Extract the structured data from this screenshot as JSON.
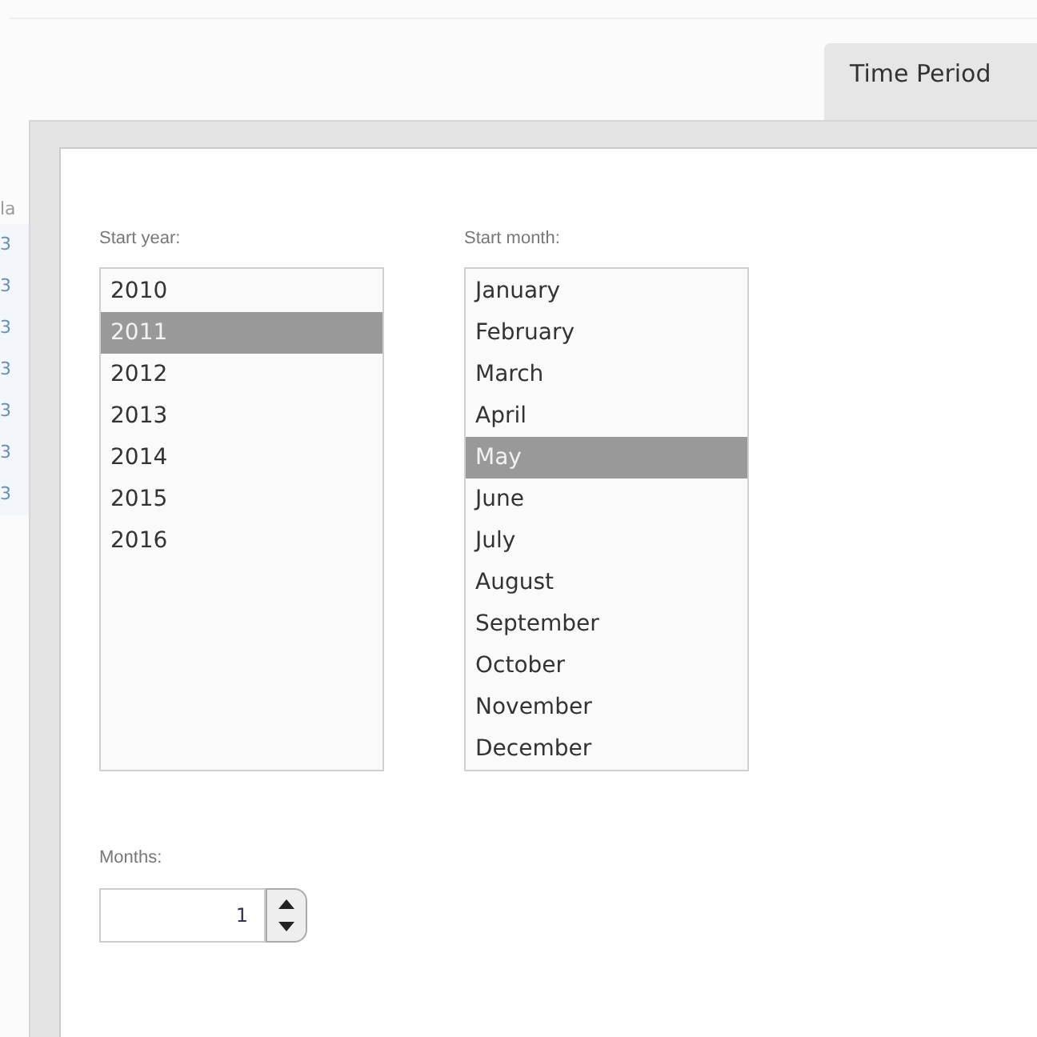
{
  "tabs": [
    {
      "label": "Time Period",
      "selected": true
    }
  ],
  "behind_table": {
    "header": "la",
    "cells": [
      "3",
      "3",
      "3",
      "3",
      "3",
      "3",
      "3"
    ]
  },
  "start_year": {
    "label": "Start year:",
    "options": [
      {
        "label": "2010",
        "selected": false
      },
      {
        "label": "2011",
        "selected": true
      },
      {
        "label": "2012",
        "selected": false
      },
      {
        "label": "2013",
        "selected": false
      },
      {
        "label": "2014",
        "selected": false
      },
      {
        "label": "2015",
        "selected": false
      },
      {
        "label": "2016",
        "selected": false
      }
    ]
  },
  "start_month": {
    "label": "Start month:",
    "options": [
      {
        "label": "January",
        "selected": false
      },
      {
        "label": "February",
        "selected": false
      },
      {
        "label": "March",
        "selected": false
      },
      {
        "label": "April",
        "selected": false
      },
      {
        "label": "May",
        "selected": true
      },
      {
        "label": "June",
        "selected": false
      },
      {
        "label": "July",
        "selected": false
      },
      {
        "label": "August",
        "selected": false
      },
      {
        "label": "September",
        "selected": false
      },
      {
        "label": "October",
        "selected": false
      },
      {
        "label": "November",
        "selected": false
      },
      {
        "label": "December",
        "selected": false
      }
    ]
  },
  "months": {
    "label": "Months:",
    "value": "1"
  }
}
